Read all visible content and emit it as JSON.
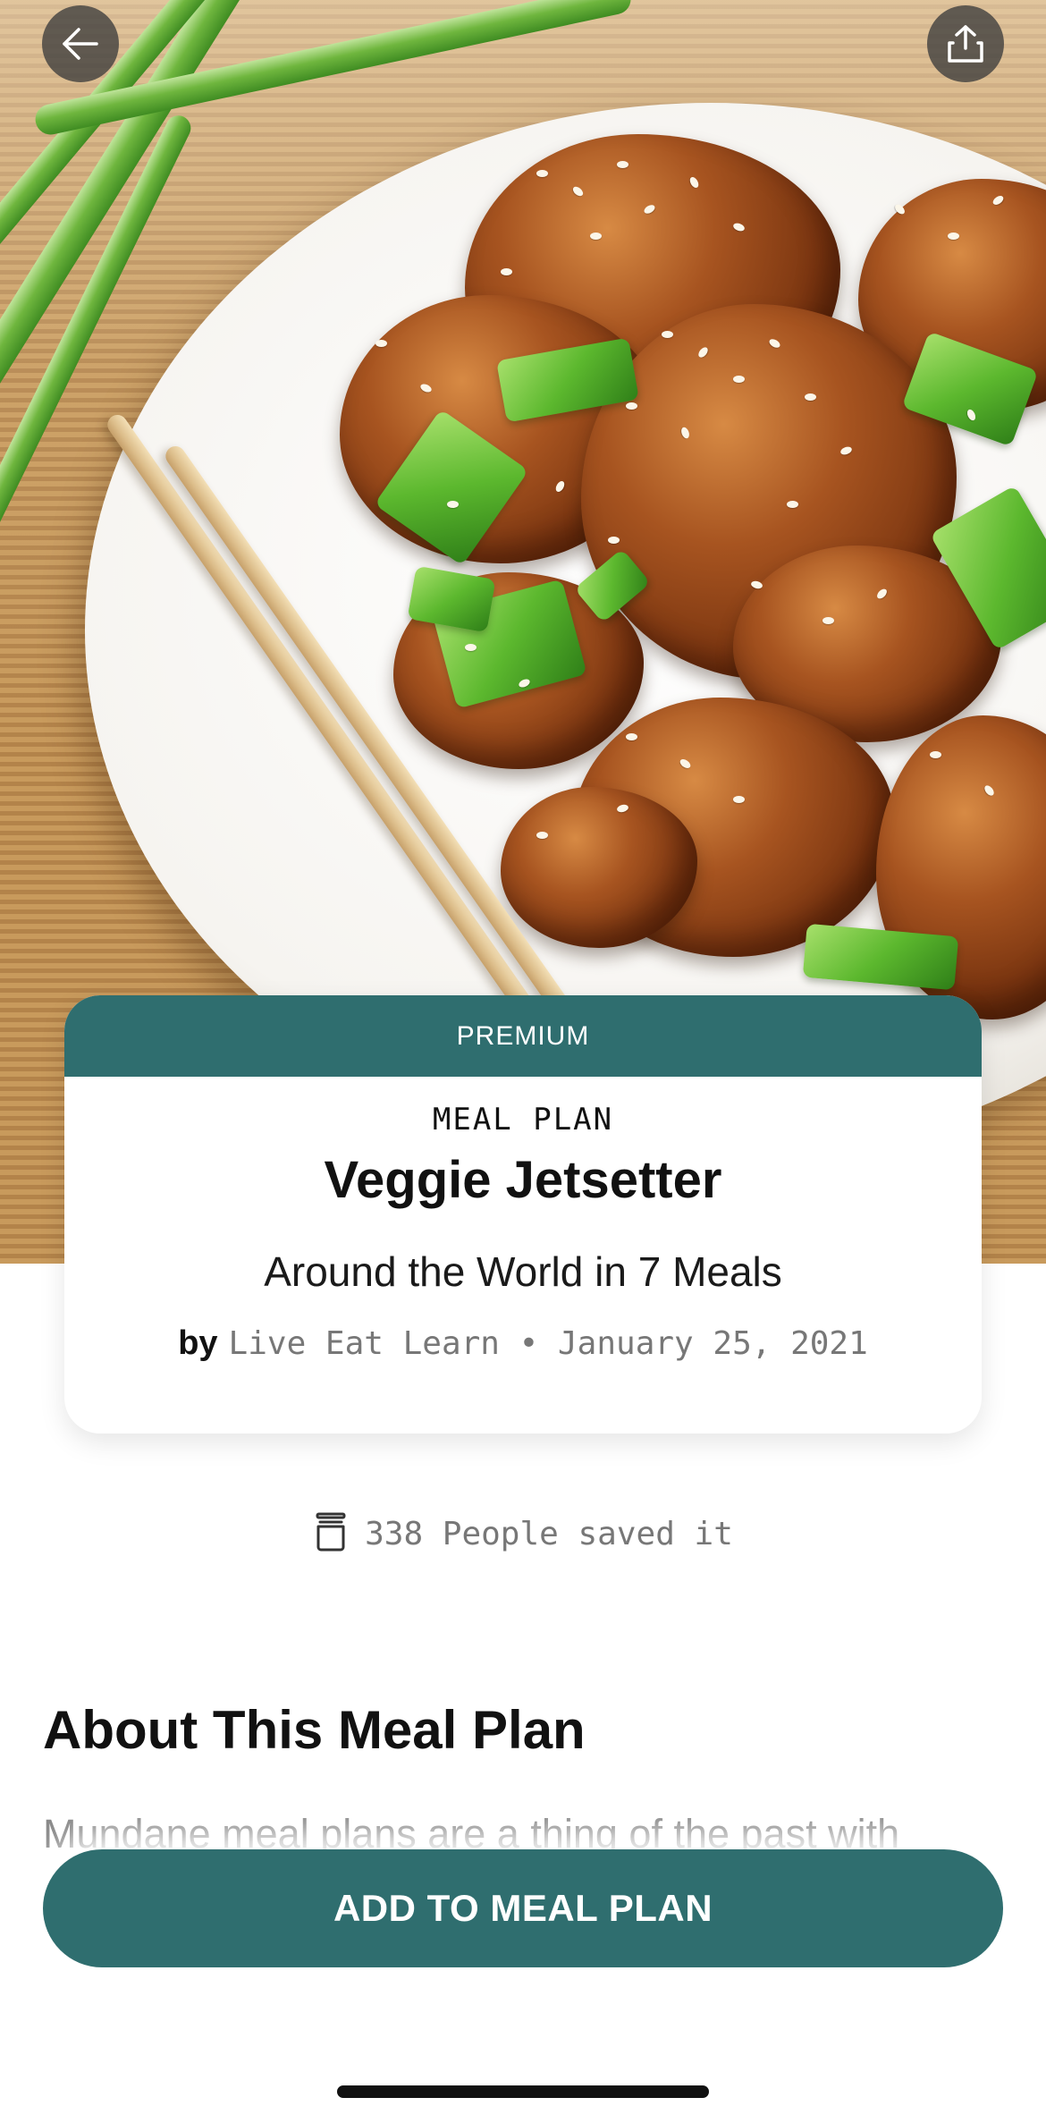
{
  "nav": {
    "back_icon": "arrow-left-icon",
    "share_icon": "share-upload-icon"
  },
  "hero": {
    "image": "glazed cauliflower bites with sesame seeds, scallions and chopsticks on a white plate"
  },
  "card": {
    "badge": "PREMIUM",
    "kind": "MEAL PLAN",
    "title": "Veggie Jetsetter",
    "subtitle": "Around the World in 7 Meals",
    "by_label": "by",
    "author_date": "Live Eat Learn • January 25, 2021"
  },
  "saved": {
    "icon": "jar-icon",
    "text": "338 People saved it"
  },
  "about": {
    "heading": "About This Meal Plan",
    "body": "Mundane meal plans are a thing of the past with"
  },
  "cta": {
    "label": "ADD TO MEAL PLAN"
  },
  "colors": {
    "brand_teal": "#2f6e6f",
    "muted_text": "#777777"
  }
}
